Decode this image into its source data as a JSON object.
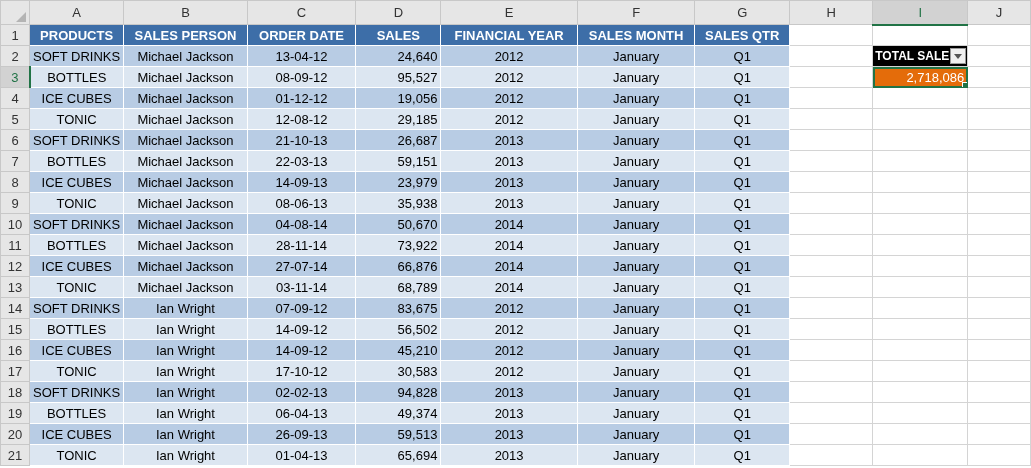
{
  "column_headers": [
    {
      "label": "A",
      "selected": false
    },
    {
      "label": "B",
      "selected": false
    },
    {
      "label": "C",
      "selected": false
    },
    {
      "label": "D",
      "selected": false
    },
    {
      "label": "E",
      "selected": false
    },
    {
      "label": "F",
      "selected": false
    },
    {
      "label": "G",
      "selected": false
    },
    {
      "label": "H",
      "selected": false
    },
    {
      "label": "I",
      "selected": true
    },
    {
      "label": "J",
      "selected": false
    }
  ],
  "row_headers": [
    {
      "label": "1",
      "selected": false
    },
    {
      "label": "2",
      "selected": false
    },
    {
      "label": "3",
      "selected": true
    },
    {
      "label": "4",
      "selected": false
    },
    {
      "label": "5",
      "selected": false
    },
    {
      "label": "6",
      "selected": false
    },
    {
      "label": "7",
      "selected": false
    },
    {
      "label": "8",
      "selected": false
    },
    {
      "label": "9",
      "selected": false
    },
    {
      "label": "10",
      "selected": false
    },
    {
      "label": "11",
      "selected": false
    },
    {
      "label": "12",
      "selected": false
    },
    {
      "label": "13",
      "selected": false
    },
    {
      "label": "14",
      "selected": false
    },
    {
      "label": "15",
      "selected": false
    },
    {
      "label": "16",
      "selected": false
    },
    {
      "label": "17",
      "selected": false
    },
    {
      "label": "18",
      "selected": false
    },
    {
      "label": "19",
      "selected": false
    },
    {
      "label": "20",
      "selected": false
    },
    {
      "label": "21",
      "selected": false
    }
  ],
  "table": {
    "columns": [
      "PRODUCTS",
      "SALES PERSON",
      "ORDER DATE",
      "SALES",
      "FINANCIAL YEAR",
      "SALES MONTH",
      "SALES QTR"
    ],
    "rows": [
      [
        "SOFT DRINKS",
        "Michael Jackson",
        "13-04-12",
        "24,640",
        "2012",
        "January",
        "Q1"
      ],
      [
        "BOTTLES",
        "Michael Jackson",
        "08-09-12",
        "95,527",
        "2012",
        "January",
        "Q1"
      ],
      [
        "ICE CUBES",
        "Michael Jackson",
        "01-12-12",
        "19,056",
        "2012",
        "January",
        "Q1"
      ],
      [
        "TONIC",
        "Michael Jackson",
        "12-08-12",
        "29,185",
        "2012",
        "January",
        "Q1"
      ],
      [
        "SOFT DRINKS",
        "Michael Jackson",
        "21-10-13",
        "26,687",
        "2013",
        "January",
        "Q1"
      ],
      [
        "BOTTLES",
        "Michael Jackson",
        "22-03-13",
        "59,151",
        "2013",
        "January",
        "Q1"
      ],
      [
        "ICE CUBES",
        "Michael Jackson",
        "14-09-13",
        "23,979",
        "2013",
        "January",
        "Q1"
      ],
      [
        "TONIC",
        "Michael Jackson",
        "08-06-13",
        "35,938",
        "2013",
        "January",
        "Q1"
      ],
      [
        "SOFT DRINKS",
        "Michael Jackson",
        "04-08-14",
        "50,670",
        "2014",
        "January",
        "Q1"
      ],
      [
        "BOTTLES",
        "Michael Jackson",
        "28-11-14",
        "73,922",
        "2014",
        "January",
        "Q1"
      ],
      [
        "ICE CUBES",
        "Michael Jackson",
        "27-07-14",
        "66,876",
        "2014",
        "January",
        "Q1"
      ],
      [
        "TONIC",
        "Michael Jackson",
        "03-11-14",
        "68,789",
        "2014",
        "January",
        "Q1"
      ],
      [
        "SOFT DRINKS",
        "Ian Wright",
        "07-09-12",
        "83,675",
        "2012",
        "January",
        "Q1"
      ],
      [
        "BOTTLES",
        "Ian Wright",
        "14-09-12",
        "56,502",
        "2012",
        "January",
        "Q1"
      ],
      [
        "ICE CUBES",
        "Ian Wright",
        "14-09-12",
        "45,210",
        "2012",
        "January",
        "Q1"
      ],
      [
        "TONIC",
        "Ian Wright",
        "17-10-12",
        "30,583",
        "2012",
        "January",
        "Q1"
      ],
      [
        "SOFT DRINKS",
        "Ian Wright",
        "02-02-13",
        "94,828",
        "2013",
        "January",
        "Q1"
      ],
      [
        "BOTTLES",
        "Ian Wright",
        "06-04-13",
        "49,374",
        "2013",
        "January",
        "Q1"
      ],
      [
        "ICE CUBES",
        "Ian Wright",
        "26-09-13",
        "59,513",
        "2013",
        "January",
        "Q1"
      ],
      [
        "TONIC",
        "Ian Wright",
        "01-04-13",
        "65,694",
        "2013",
        "January",
        "Q1"
      ]
    ]
  },
  "total": {
    "header": "TOTAL SALE",
    "value": "2,718,086",
    "selected": true
  }
}
